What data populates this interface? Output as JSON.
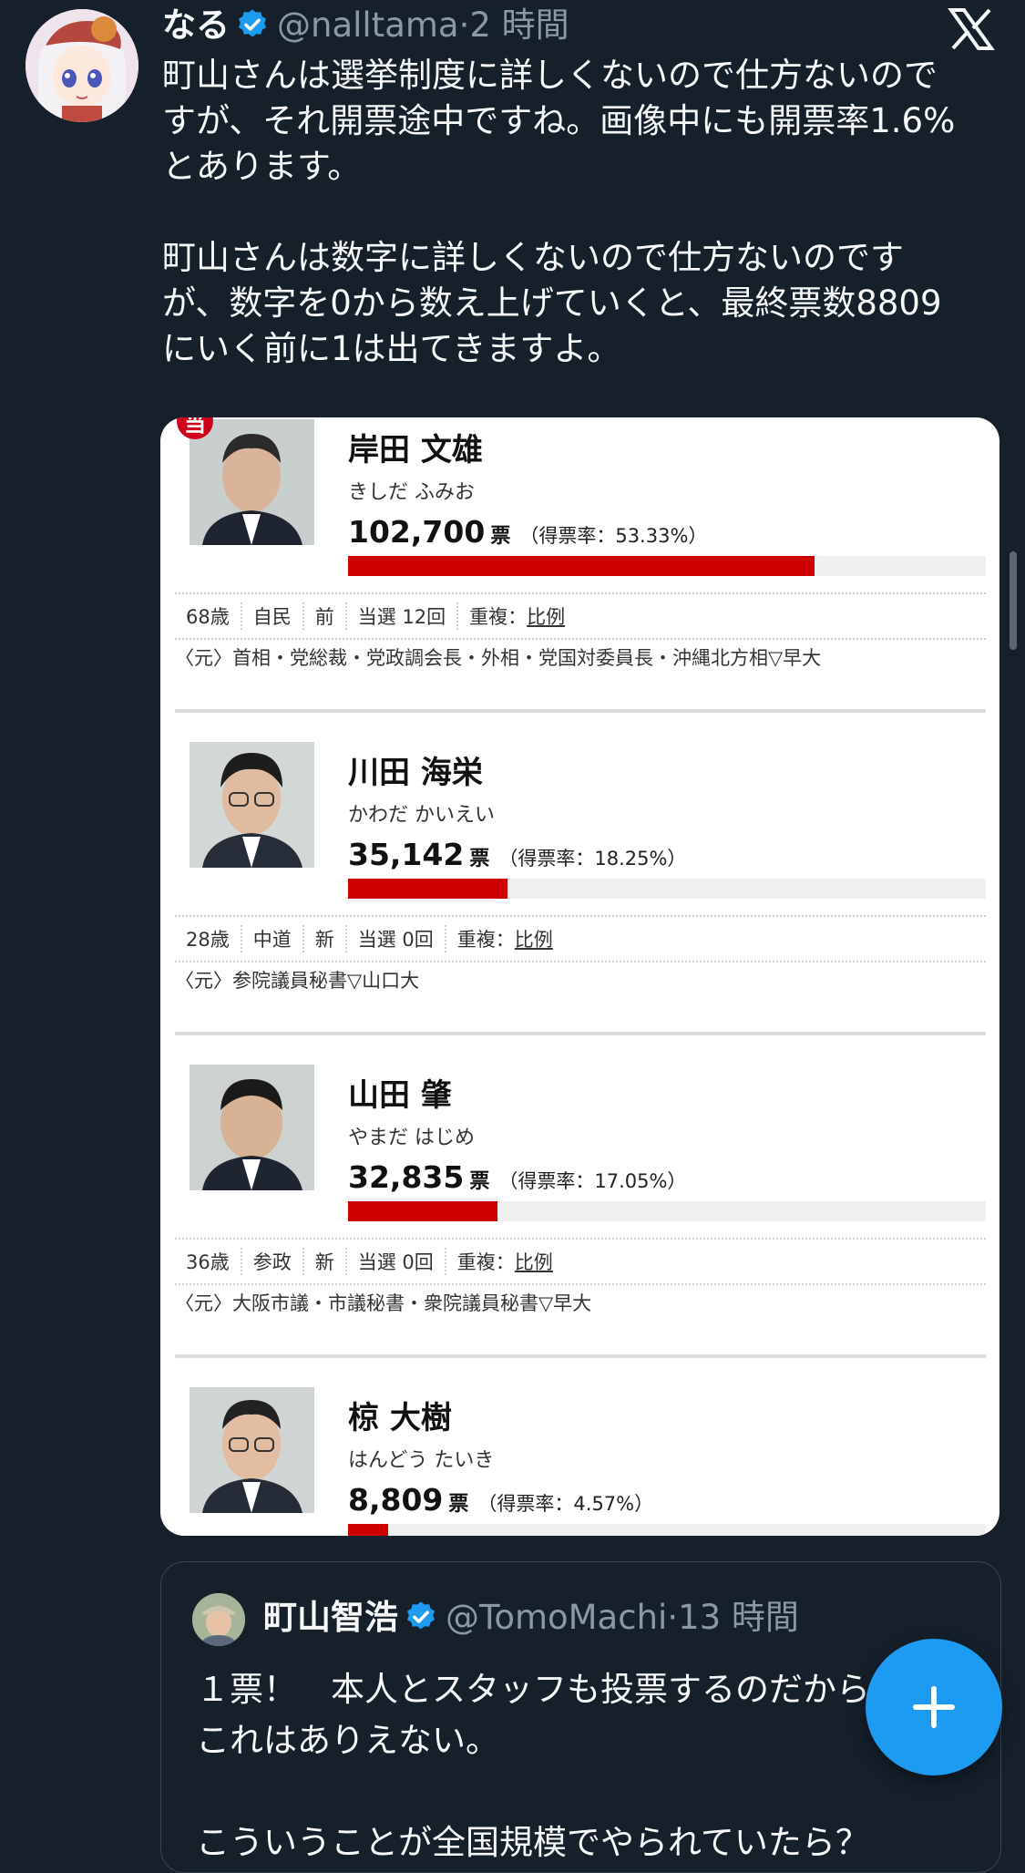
{
  "tweet": {
    "author_name": "なる",
    "handle": "@nalltama",
    "separator": "·",
    "time": "2 時間",
    "text_lines": [
      "町山さんは選挙制度に詳しくないので仕方ないので",
      "すが、それ開票途中ですね。画像中にも開票率1.6%",
      "とあります。",
      "",
      "町山さんは数字に詳しくないので仕方ないのです",
      "が、数字を0から数え上げていくと、最終票数8809",
      "にいく前に1は出てきますよ。"
    ]
  },
  "icons": {
    "verified": "verified-badge-icon",
    "logo": "x-logo-icon",
    "compose": "plus-icon"
  },
  "colors": {
    "background": "#15202b",
    "accent": "#1d9bf0",
    "bar": "#cc0000"
  },
  "media": {
    "candidates": [
      {
        "elected_badge": "当",
        "name": "岸田 文雄",
        "kana": "きしだ ふみお",
        "votes": "102,700",
        "votes_unit": "票",
        "rate_text": "（得票率：53.33%）",
        "rate": 0.5333,
        "age": "68歳",
        "party": "自民",
        "status": "前",
        "times": "当選 12回",
        "dual_label": "重複：",
        "dual_value": "比例",
        "career": "〈元〉首相・党総裁・党政調会長・外相・党国対委員長・沖縄北方相▽早大"
      },
      {
        "elected_badge": "",
        "name": "川田 海栄",
        "kana": "かわだ かいえい",
        "votes": "35,142",
        "votes_unit": "票",
        "rate_text": "（得票率：18.25%）",
        "rate": 0.1825,
        "age": "28歳",
        "party": "中道",
        "status": "新",
        "times": "当選 0回",
        "dual_label": "重複：",
        "dual_value": "比例",
        "career": "〈元〉参院議員秘書▽山口大"
      },
      {
        "elected_badge": "",
        "name": "山田 肇",
        "kana": "やまだ はじめ",
        "votes": "32,835",
        "votes_unit": "票",
        "rate_text": "（得票率：17.05%）",
        "rate": 0.1705,
        "age": "36歳",
        "party": "参政",
        "status": "新",
        "times": "当選 0回",
        "dual_label": "重複：",
        "dual_value": "比例",
        "career": "〈元〉大阪市議・市議秘書・衆院議員秘書▽早大"
      },
      {
        "elected_badge": "",
        "name": "椋 大樹",
        "kana": "はんどう たいき",
        "votes": "8,809",
        "votes_unit": "票",
        "rate_text": "（得票率：4.57%）",
        "rate": 0.0457
      }
    ]
  },
  "quote": {
    "author_name": "町山智浩",
    "handle": "@TomoMachi",
    "separator": "·",
    "time": "13 時間",
    "text_lines": [
      "１票！　本人とスタッフも投票するのだから",
      "これはありえない。",
      "",
      "こういうことが全国規模でやられていたら？"
    ]
  }
}
